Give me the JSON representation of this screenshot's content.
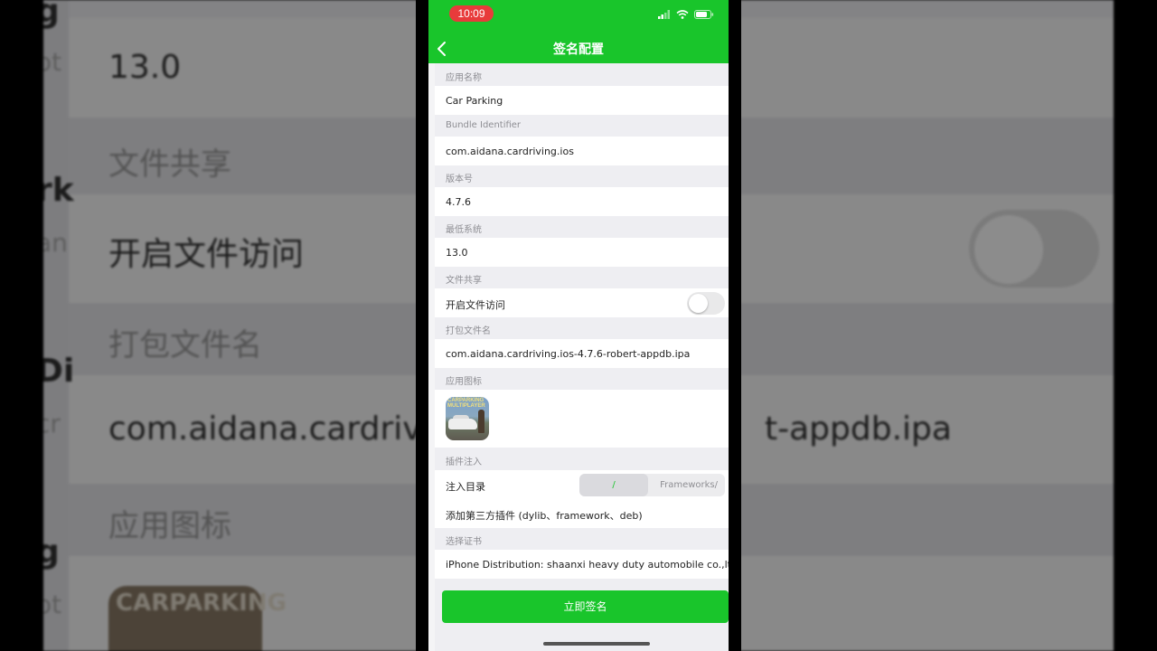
{
  "status_bar": {
    "time": "10:09"
  },
  "nav": {
    "title": "签名配置"
  },
  "sections": {
    "app_name": {
      "label": "应用名称",
      "value": "Car Parking"
    },
    "bundle_id": {
      "label": "Bundle Identifier",
      "value": "com.aidana.cardriving.ios"
    },
    "version": {
      "label": "版本号",
      "value": "4.7.6"
    },
    "min_os": {
      "label": "最低系统",
      "value": "13.0"
    },
    "file_sharing": {
      "label": "文件共享",
      "row_label": "开启文件访问",
      "enabled": false
    },
    "package_name": {
      "label": "打包文件名",
      "value": "com.aidana.cardriving.ios-4.7.6-robert-appdb.ipa"
    },
    "app_icon": {
      "label": "应用图标",
      "icon_text_1": "CARPARKING",
      "icon_text_2": "MULTIPLAYER"
    },
    "plugin": {
      "label": "插件注入",
      "inject_dir_label": "注入目录",
      "options": [
        "/",
        "Frameworks/"
      ],
      "selected": "/",
      "add_plugin_label": "添加第三方插件 (dylib、framework、deb)"
    },
    "certificate": {
      "label": "选择证书",
      "value": "iPhone Distribution: shaanxi heavy duty automobile co.,ltd"
    }
  },
  "sign_button": "立即签名",
  "background": {
    "texts": [
      "13.0",
      "文件共享",
      "开启文件访问",
      "打包文件名",
      "com.aidana.cardriv",
      "t-appdb.ipa",
      "应用图标"
    ],
    "left_fragments": [
      "g",
      "ot",
      "rk",
      "an",
      "Di",
      "cr",
      "g",
      "ot"
    ]
  },
  "colors": {
    "accent": "#19c52b",
    "time_pill": "#e83b3b",
    "section_bg": "#eeeef2"
  }
}
